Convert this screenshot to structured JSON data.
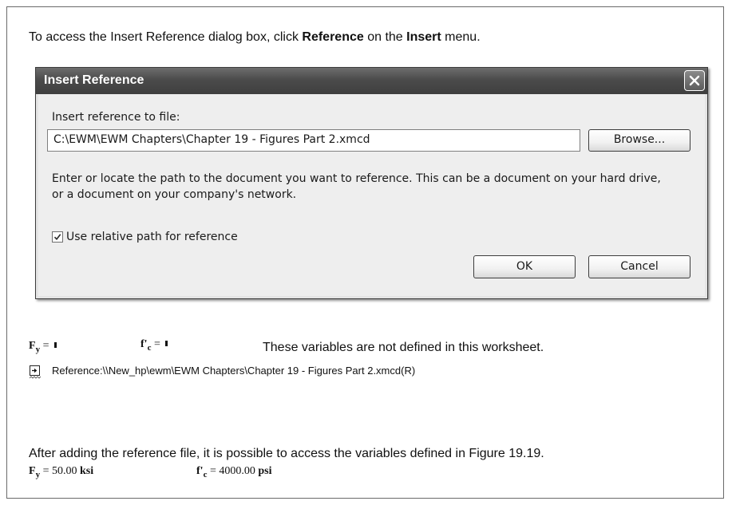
{
  "intro": {
    "part1": "To access the Insert Reference dialog box, click ",
    "bold1": "Reference",
    "part2": " on the ",
    "bold2": "Insert",
    "part3": " menu."
  },
  "dialog": {
    "title": "Insert Reference",
    "close_icon": "close-icon",
    "field_label": "Insert reference to file:",
    "path_value": "C:\\EWM\\EWM Chapters\\Chapter 19 - Figures Part 2.xmcd",
    "browse_label": "Browse...",
    "description": "Enter or locate the path to the document you want to reference. This can be a document on your hard drive, or a document on your company's network.",
    "checkbox_label": "Use relative path for reference",
    "checkbox_checked": true,
    "ok_label": "OK",
    "cancel_label": "Cancel"
  },
  "worksheet": {
    "fy_symbol": "F",
    "fy_sub": "y",
    "fc_symbol": "f'",
    "fc_sub": "c",
    "equals": " = ",
    "undefined_message": "These variables are not defined in this worksheet.",
    "reference_icon": "reference-arrow-icon",
    "reference_text": "Reference:\\\\New_hp\\ewm\\EWM Chapters\\Chapter 19 - Figures Part 2.xmcd(R)",
    "after_text": "After adding the reference file, it is possible to access the variables defined in Figure 19.19.",
    "fy_value": "50.00",
    "fy_unit": "ksi",
    "fc_value": "4000.00",
    "fc_unit": "psi"
  }
}
